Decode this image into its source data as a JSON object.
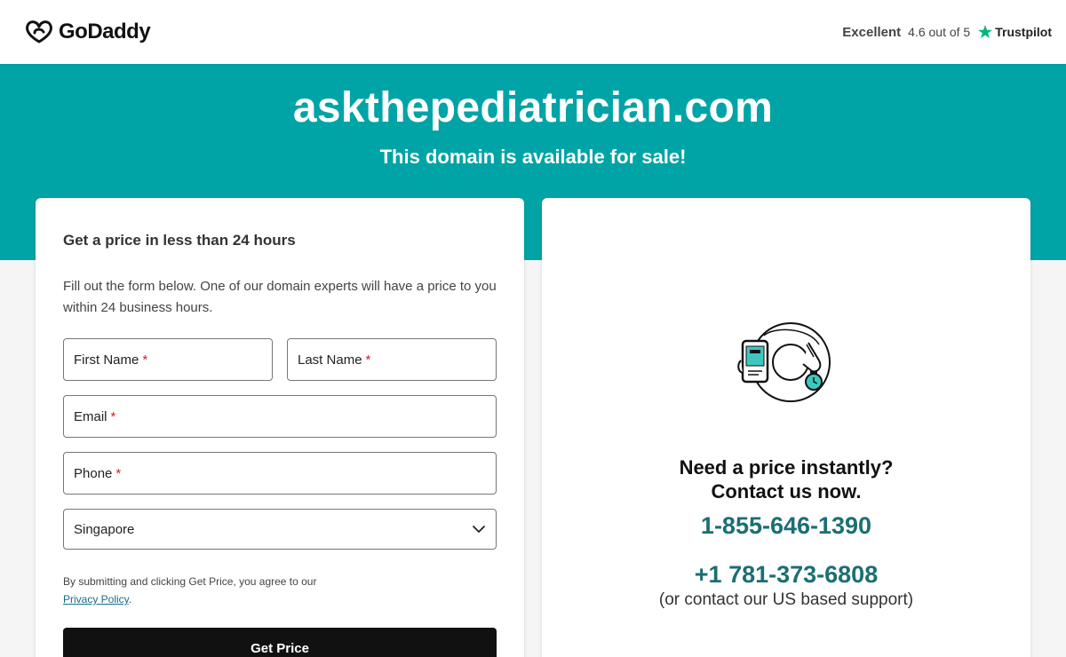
{
  "header": {
    "logo_text": "GoDaddy",
    "trust_rating_label": "Excellent",
    "trust_score": "4.6 out of 5",
    "trust_brand": "Trustpilot"
  },
  "hero": {
    "domain": "askthepediatrician.com",
    "subtitle": "This domain is available for sale!"
  },
  "form": {
    "title": "Get a price in less than 24 hours",
    "description": "Fill out the form below. One of our domain experts will have a price to you within 24 business hours.",
    "first_name_label": "First Name",
    "last_name_label": "Last Name",
    "email_label": "Email",
    "phone_label": "Phone",
    "required_mark": "*",
    "country_value": "Singapore",
    "legal_text": "By submitting and clicking Get Price, you agree to our",
    "privacy_link": "Privacy Policy",
    "legal_end": ".",
    "submit_label": "Get Price"
  },
  "contact": {
    "heading_line1": "Need a price instantly?",
    "heading_line2": "Contact us now.",
    "phone_primary": "1-855-646-1390",
    "phone_secondary": "+1 781-373-6808",
    "phone_note": "(or contact our US based support)"
  },
  "colors": {
    "hero_bg": "#00a4a6",
    "phone_text": "#1b6f73",
    "button_bg": "#111111",
    "required": "#d0202c",
    "trustpilot_star": "#00b67a"
  }
}
